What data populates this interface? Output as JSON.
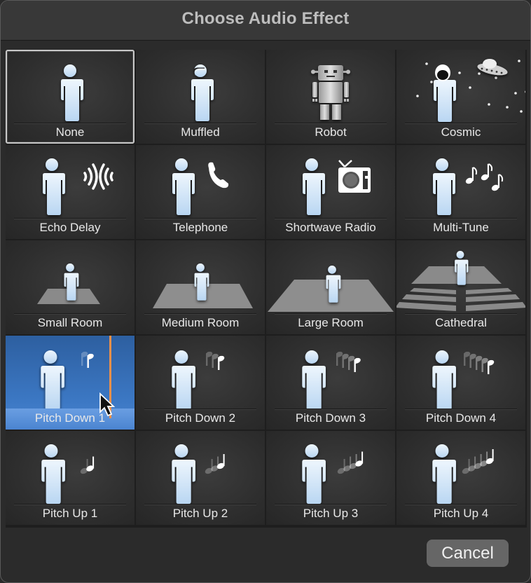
{
  "dialog": {
    "title": "Choose Audio Effect",
    "cancel_label": "Cancel"
  },
  "effects": [
    {
      "id": "none",
      "label": "None",
      "icon": "person-icon",
      "state": "current"
    },
    {
      "id": "muffled",
      "label": "Muffled",
      "icon": "person-muffled-icon"
    },
    {
      "id": "robot",
      "label": "Robot",
      "icon": "robot-icon"
    },
    {
      "id": "cosmic",
      "label": "Cosmic",
      "icon": "astronaut-ufo-icon"
    },
    {
      "id": "echo-delay",
      "label": "Echo Delay",
      "icon": "echo-waves-icon"
    },
    {
      "id": "telephone",
      "label": "Telephone",
      "icon": "phone-icon"
    },
    {
      "id": "shortwave-radio",
      "label": "Shortwave Radio",
      "icon": "radio-icon"
    },
    {
      "id": "multi-tune",
      "label": "Multi-Tune",
      "icon": "music-notes-icon"
    },
    {
      "id": "small-room",
      "label": "Small Room",
      "icon": "small-room-icon"
    },
    {
      "id": "medium-room",
      "label": "Medium Room",
      "icon": "medium-room-icon"
    },
    {
      "id": "large-room",
      "label": "Large Room",
      "icon": "large-room-icon"
    },
    {
      "id": "cathedral",
      "label": "Cathedral",
      "icon": "cathedral-icon"
    },
    {
      "id": "pitch-down-1",
      "label": "Pitch Down 1",
      "icon": "pitch-down-notes-icon",
      "notes": 1,
      "state": "hover"
    },
    {
      "id": "pitch-down-2",
      "label": "Pitch Down 2",
      "icon": "pitch-down-notes-icon",
      "notes": 2
    },
    {
      "id": "pitch-down-3",
      "label": "Pitch Down 3",
      "icon": "pitch-down-notes-icon",
      "notes": 3
    },
    {
      "id": "pitch-down-4",
      "label": "Pitch Down 4",
      "icon": "pitch-down-notes-icon",
      "notes": 4
    },
    {
      "id": "pitch-up-1",
      "label": "Pitch Up 1",
      "icon": "pitch-up-notes-icon",
      "notes": 1
    },
    {
      "id": "pitch-up-2",
      "label": "Pitch Up 2",
      "icon": "pitch-up-notes-icon",
      "notes": 2
    },
    {
      "id": "pitch-up-3",
      "label": "Pitch Up 3",
      "icon": "pitch-up-notes-icon",
      "notes": 3
    },
    {
      "id": "pitch-up-4",
      "label": "Pitch Up 4",
      "icon": "pitch-up-notes-icon",
      "notes": 4
    }
  ],
  "colors": {
    "person_fill": "#cfe4f7",
    "hover_blue": "#3c78c4",
    "playhead": "#f0904a"
  }
}
